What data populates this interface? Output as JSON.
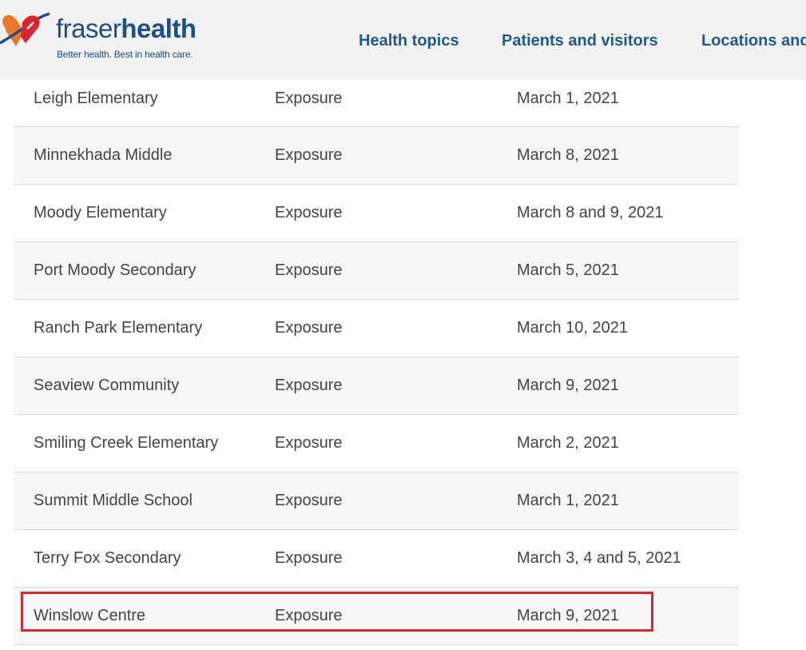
{
  "header": {
    "logo": {
      "word_light": "fraser",
      "word_bold": "health",
      "tagline": "Better health. Best in health care."
    },
    "nav": [
      {
        "label": "Health topics"
      },
      {
        "label": "Patients and visitors"
      },
      {
        "label": "Locations and"
      }
    ]
  },
  "colors": {
    "brand_blue": "#1c4f85",
    "nav_blue": "#1e5a8e",
    "logo_orange": "#e8782a",
    "logo_red": "#d6262e",
    "highlight_red": "#d6262e",
    "header_bg": "#f1f1f1",
    "row_shade": "#f7f7f7"
  },
  "table": {
    "rows": [
      {
        "name": "Leigh Elementary",
        "status": "Exposure",
        "date": "March 1, 2021"
      },
      {
        "name": "Minnekhada Middle",
        "status": "Exposure",
        "date": "March 8, 2021"
      },
      {
        "name": "Moody Elementary",
        "status": "Exposure",
        "date": "March 8 and 9, 2021"
      },
      {
        "name": "Port Moody Secondary",
        "status": "Exposure",
        "date": "March 5, 2021"
      },
      {
        "name": "Ranch Park Elementary",
        "status": "Exposure",
        "date": "March 10, 2021"
      },
      {
        "name": "Seaview Community",
        "status": "Exposure",
        "date": "March 9, 2021"
      },
      {
        "name": "Smiling Creek Elementary",
        "status": "Exposure",
        "date": "March 2, 2021"
      },
      {
        "name": "Summit Middle School",
        "status": "Exposure",
        "date": "March 1, 2021"
      },
      {
        "name": "Terry Fox Secondary",
        "status": "Exposure",
        "date": "March 3, 4 and 5, 2021"
      },
      {
        "name": "Winslow Centre",
        "status": "Exposure",
        "date": "March 9, 2021"
      }
    ]
  }
}
